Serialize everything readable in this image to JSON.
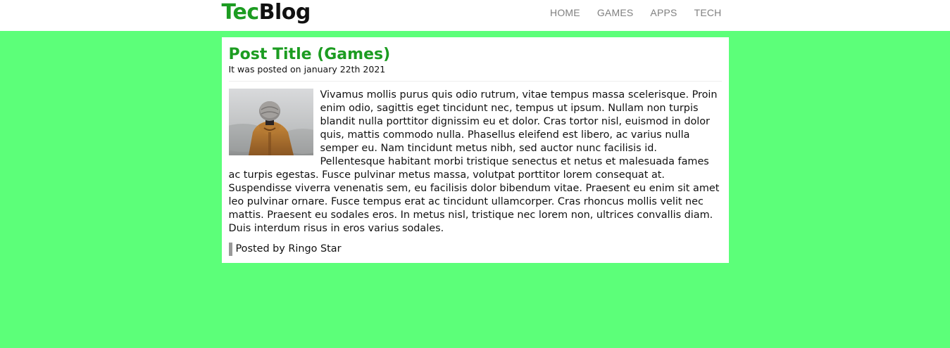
{
  "header": {
    "logo_part1": "Tec",
    "logo_part2": "Blog",
    "nav": [
      {
        "label": "HOME"
      },
      {
        "label": "GAMES"
      },
      {
        "label": "APPS"
      },
      {
        "label": "TECH"
      }
    ]
  },
  "post": {
    "title": "Post Title (Games)",
    "date": "It was posted on january 22th 2021",
    "image_icon": "person-in-beanie-photo",
    "body": "Vivamus mollis purus quis odio rutrum, vitae tempus massa scelerisque. Proin enim odio, sagittis eget tincidunt nec, tempus ut ipsum. Nullam non turpis blandit nulla porttitor dignissim eu et dolor. Cras tortor nisl, euismod in dolor quis, mattis commodo nulla. Phasellus eleifend est libero, ac varius nulla semper eu. Nam tincidunt metus nibh, sed auctor nunc facilisis id. Pellentesque habitant morbi tristique senectus et netus et malesuada fames ac turpis egestas. Fusce pulvinar metus massa, volutpat porttitor lorem consequat at. Suspendisse viverra venenatis sem, eu facilisis dolor bibendum vitae. Praesent eu enim sit amet leo pulvinar ornare. Fusce tempus erat ac tincidunt ullamcorper. Cras rhoncus mollis velit nec mattis. Praesent eu sodales eros. In metus nisl, tristique nec lorem non, ultrices convallis diam. Duis interdum risus in eros varius sodales.",
    "author": "Posted by Ringo Star"
  },
  "colors": {
    "page_background": "#5cff79",
    "brand_green": "#1c9c21",
    "nav_text": "#808080"
  }
}
